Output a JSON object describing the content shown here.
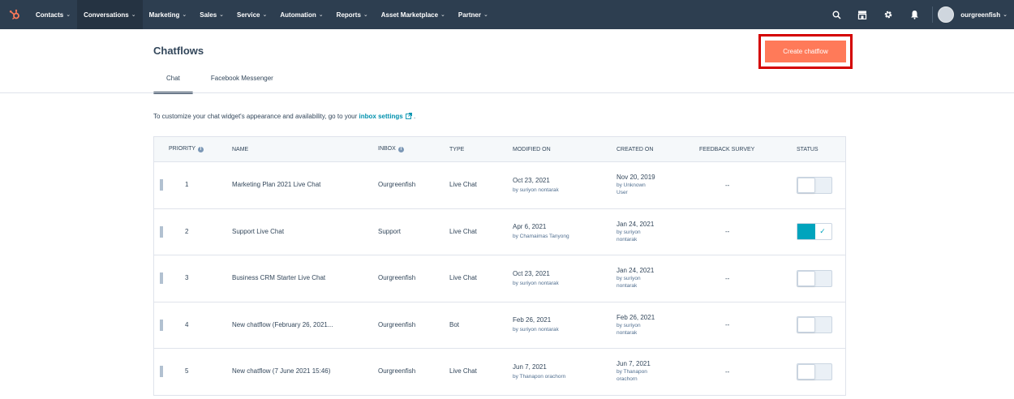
{
  "colors": {
    "nav_bg": "#2d3e50",
    "accent": "#ff7a59",
    "teal": "#00a4bd",
    "highlight_border": "#d40000"
  },
  "nav": {
    "items": [
      {
        "label": "Contacts",
        "active": false
      },
      {
        "label": "Conversations",
        "active": true
      },
      {
        "label": "Marketing",
        "active": false
      },
      {
        "label": "Sales",
        "active": false
      },
      {
        "label": "Service",
        "active": false
      },
      {
        "label": "Automation",
        "active": false
      },
      {
        "label": "Reports",
        "active": false
      },
      {
        "label": "Asset Marketplace",
        "active": false
      },
      {
        "label": "Partner",
        "active": false
      }
    ],
    "icons": [
      "search-icon",
      "marketplace-icon",
      "settings-icon",
      "notifications-icon"
    ],
    "account_name": "ourgreenfish"
  },
  "page": {
    "title": "Chatflows",
    "create_button": "Create chatflow",
    "tabs": [
      "Chat",
      "Facebook Messenger"
    ],
    "info_text": "To customize your chat widget's appearance and availability, go to your",
    "info_link": "inbox settings",
    "info_end": "."
  },
  "table": {
    "headers": {
      "priority": "PRIORITY",
      "name": "NAME",
      "inbox": "INBOX",
      "type": "TYPE",
      "modified": "MODIFIED ON",
      "created": "CREATED ON",
      "feedback": "FEEDBACK SURVEY",
      "status": "STATUS"
    },
    "rows": [
      {
        "priority": "1",
        "name": "Marketing Plan 2021 Live Chat",
        "inbox": "Ourgreenfish",
        "type": "Live Chat",
        "modified_date": "Oct 23, 2021",
        "modified_by": "by suriyon nontarak",
        "created_date": "Nov 20, 2019",
        "created_by_1": "by Unknown",
        "created_by_2": "User",
        "feedback": "--",
        "status_on": false
      },
      {
        "priority": "2",
        "name": "Support Live Chat",
        "inbox": "Support",
        "type": "Live Chat",
        "modified_date": "Apr 6, 2021",
        "modified_by": "by Chamaimas Tanyong",
        "created_date": "Jan 24, 2021",
        "created_by_1": "by suriyon",
        "created_by_2": "nontarak",
        "feedback": "--",
        "status_on": true
      },
      {
        "priority": "3",
        "name": "Business CRM Starter Live Chat",
        "inbox": "Ourgreenfish",
        "type": "Live Chat",
        "modified_date": "Oct 23, 2021",
        "modified_by": "by suriyon nontarak",
        "created_date": "Jan 24, 2021",
        "created_by_1": "by suriyon",
        "created_by_2": "nontarak",
        "feedback": "--",
        "status_on": false
      },
      {
        "priority": "4",
        "name": "New chatflow (February 26, 2021...",
        "inbox": "Ourgreenfish",
        "type": "Bot",
        "modified_date": "Feb 26, 2021",
        "modified_by": "by suriyon nontarak",
        "created_date": "Feb 26, 2021",
        "created_by_1": "by suriyon",
        "created_by_2": "nontarak",
        "feedback": "--",
        "status_on": false
      },
      {
        "priority": "5",
        "name": "New chatflow (7 June 2021 15:46)",
        "inbox": "Ourgreenfish",
        "type": "Live Chat",
        "modified_date": "Jun 7, 2021",
        "modified_by": "by Thanapon orachorn",
        "created_date": "Jun 7, 2021",
        "created_by_1": "by Thanapon",
        "created_by_2": "orachorn",
        "feedback": "--",
        "status_on": false
      }
    ]
  }
}
